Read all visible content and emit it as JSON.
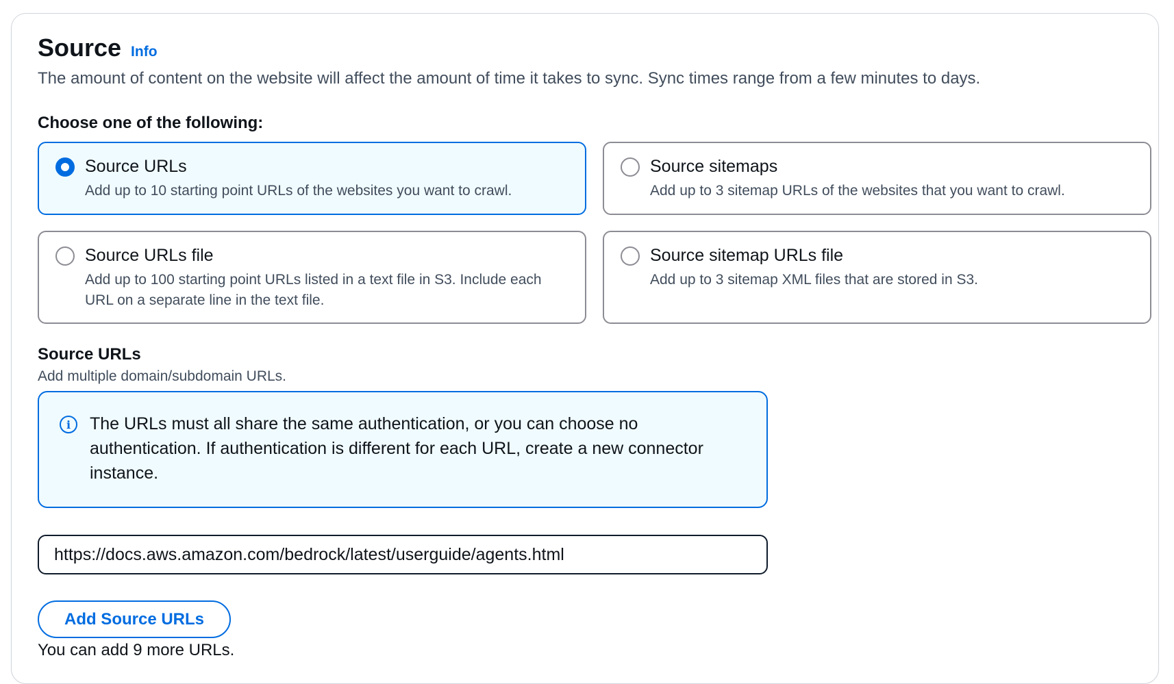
{
  "section": {
    "title": "Source",
    "info_link": "Info",
    "description": "The amount of content on the website will affect the amount of time it takes to sync. Sync times range from a few minutes to days."
  },
  "choice": {
    "label": "Choose one of the following:",
    "options": [
      {
        "title": "Source URLs",
        "description": "Add up to 10 starting point URLs of the websites you want to crawl.",
        "selected": true
      },
      {
        "title": "Source sitemaps",
        "description": "Add up to 3 sitemap URLs of the websites that you want to crawl.",
        "selected": false
      },
      {
        "title": "Source URLs file",
        "description": "Add up to 100 starting point URLs listed in a text file in S3. Include each URL on a separate line in the text file.",
        "selected": false
      },
      {
        "title": "Source sitemap URLs file",
        "description": "Add up to 3 sitemap XML files that are stored in S3.",
        "selected": false
      }
    ]
  },
  "source_urls": {
    "label": "Source URLs",
    "description": "Add multiple domain/subdomain URLs.",
    "alert": {
      "icon": "info-circle-icon",
      "text": "The URLs must all share the same authentication, or you can choose no authentication. If authentication is different for each URL, create a new connector instance."
    },
    "url_value": "https://docs.aws.amazon.com/bedrock/latest/userguide/agents.html",
    "add_button": "Add Source URLs",
    "helper_text": "You can add 9 more URLs."
  },
  "colors": {
    "accent": "#006ce0",
    "selected_background": "#f0fbff",
    "border": "#8c8c94",
    "text": "#0f141a",
    "secondary_text": "#414d5c"
  }
}
